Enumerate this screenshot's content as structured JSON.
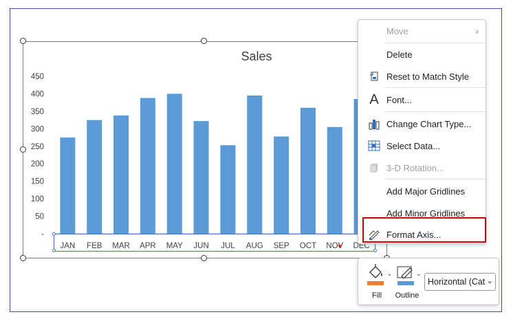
{
  "chart_data": {
    "type": "bar",
    "title": "Sales",
    "categories": [
      "JAN",
      "FEB",
      "MAR",
      "APR",
      "MAY",
      "JUN",
      "JUL",
      "AUG",
      "SEP",
      "OCT",
      "NOV",
      "DEC"
    ],
    "values": [
      275,
      325,
      338,
      388,
      400,
      322,
      253,
      395,
      278,
      360,
      305,
      385
    ],
    "yticks": [
      "-",
      "50",
      "100",
      "150",
      "200",
      "250",
      "300",
      "350",
      "400",
      "450"
    ],
    "ylim": [
      0,
      450
    ],
    "bar_color": "#5b9bd5",
    "grid": false
  },
  "context_menu": {
    "items": [
      {
        "label": "Move",
        "disabled": true,
        "submenu": true,
        "icon": ""
      },
      {
        "label": "Delete",
        "disabled": false,
        "icon": ""
      },
      {
        "label": "Reset to Match Style",
        "disabled": false,
        "icon": "reset-style-icon"
      },
      {
        "label": "Font...",
        "disabled": false,
        "icon": "font-icon"
      },
      {
        "label": "Change Chart Type...",
        "disabled": false,
        "icon": "chart-type-icon"
      },
      {
        "label": "Select Data...",
        "disabled": false,
        "icon": "select-data-icon"
      },
      {
        "label": "3-D Rotation...",
        "disabled": true,
        "icon": "rotation-3d-icon"
      },
      {
        "label": "Add Major Gridlines",
        "disabled": false,
        "icon": ""
      },
      {
        "label": "Add Minor Gridlines",
        "disabled": false,
        "icon": ""
      },
      {
        "label": "Format Axis...",
        "disabled": false,
        "icon": "format-axis-icon"
      }
    ],
    "highlight_color": "#d00000"
  },
  "mini_toolbar": {
    "fill_label": "Fill",
    "outline_label": "Outline",
    "fill_color": "#ed7d31",
    "outline_color": "#5b9bd5",
    "element_select": "Horizontal (Cat"
  }
}
